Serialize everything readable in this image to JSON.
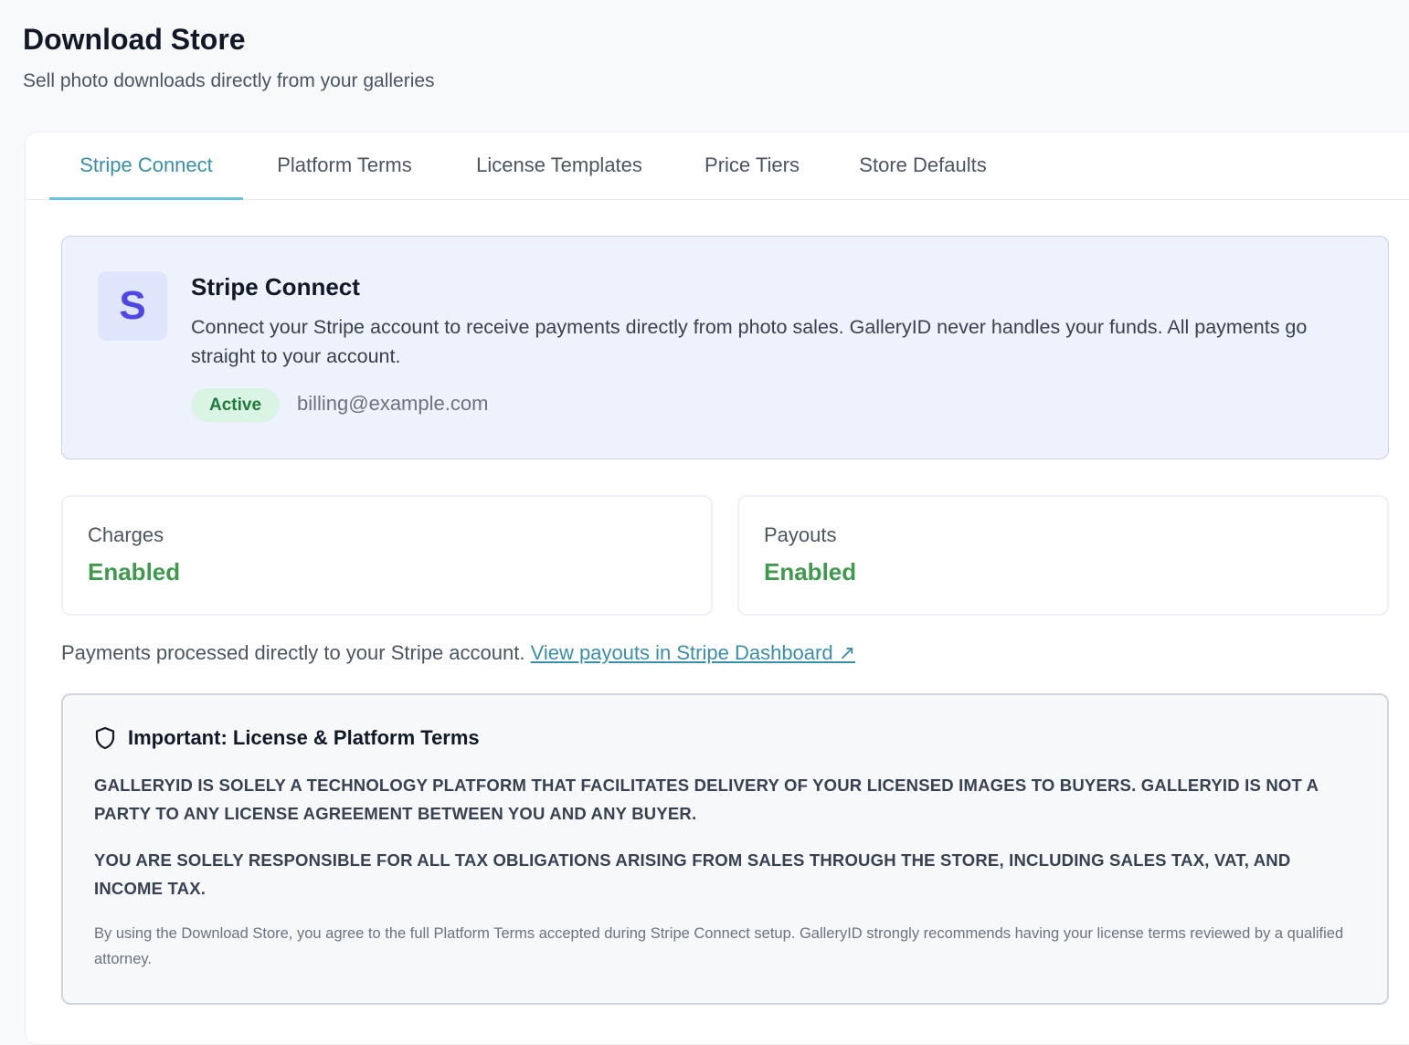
{
  "page": {
    "title": "Download Store",
    "subtitle": "Sell photo downloads directly from your galleries"
  },
  "tabs": [
    {
      "label": "Stripe Connect",
      "active": true
    },
    {
      "label": "Platform Terms",
      "active": false
    },
    {
      "label": "License Templates",
      "active": false
    },
    {
      "label": "Price Tiers",
      "active": false
    },
    {
      "label": "Store Defaults",
      "active": false
    }
  ],
  "stripe": {
    "logo_letter": "S",
    "title": "Stripe Connect",
    "description": "Connect your Stripe account to receive payments directly from photo sales. GalleryID never handles your funds. All payments go straight to your account.",
    "status": "Active",
    "email": "billing@example.com"
  },
  "stats": [
    {
      "label": "Charges",
      "value": "Enabled"
    },
    {
      "label": "Payouts",
      "value": "Enabled"
    }
  ],
  "payments_note": {
    "text": "Payments processed directly to your Stripe account. ",
    "link": "View payouts in Stripe Dashboard ↗"
  },
  "terms": {
    "icon": "shield-icon",
    "title": "Important: License & Platform Terms",
    "para1": "GalleryID is solely a technology platform that facilitates delivery of your licensed images to buyers. GalleryID is not a party to any license agreement between you and any buyer.",
    "para2": "You are solely responsible for all tax obligations arising from sales through the store, including sales tax, VAT, and income tax.",
    "note": "By using the Download Store, you agree to the full Platform Terms accepted during Stripe Connect setup. GalleryID strongly recommends having your license terms reviewed by a qualified attorney."
  },
  "colors": {
    "accent": "#3a8ea7",
    "success": "#3f9a4e",
    "stripe_brand": "#5046e5"
  }
}
